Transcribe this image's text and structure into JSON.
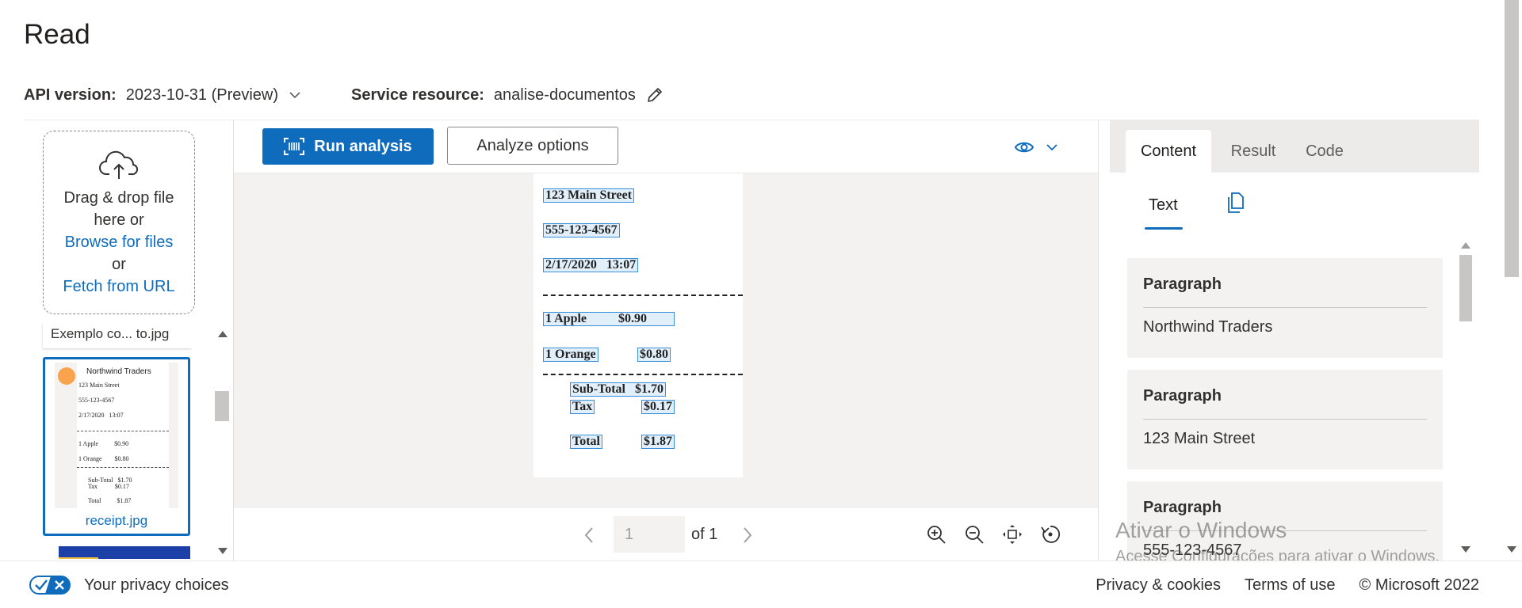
{
  "page": {
    "title": "Read"
  },
  "settings": {
    "api_version_label": "API version:",
    "api_version_value": "2023-10-31 (Preview)",
    "service_resource_label": "Service resource:",
    "service_resource_value": "analise-documentos"
  },
  "upload": {
    "line1": "Drag & drop file",
    "line2": "here or",
    "browse_link": "Browse for files",
    "or": "or",
    "fetch_link": "Fetch from URL"
  },
  "files": {
    "items": [
      {
        "name": "Exemplo co...  to.jpg",
        "selected": false
      },
      {
        "name": "receipt.jpg",
        "selected": true
      }
    ],
    "thumb_lines": {
      "company": "Northwind Traders",
      "street": "123 Main Street",
      "phone": "555-123-4567",
      "datetime": "2/17/2020   13:07",
      "apple": "1 Apple          $0.90",
      "orange": "1 Orange        $0.80",
      "subtotal": "Sub-Total   $1.70",
      "tax": "Tax           $0.17",
      "total": "Total          $1.87"
    }
  },
  "toolbar": {
    "run_label": "Run analysis",
    "analyze_label": "Analyze options"
  },
  "document": {
    "street": "123 Main Street",
    "phone": "555-123-4567",
    "datetime": "2/17/2020   13:07",
    "apple": "1 Apple          $0.90",
    "orange": "1 Orange",
    "orange_price": "$0.80",
    "subtotal": "Sub-Total   $1.70",
    "tax": "Tax",
    "tax_price": "$0.17",
    "total": "Total",
    "total_price": "$1.87"
  },
  "pager": {
    "current_page": "1",
    "of_text": "of 1"
  },
  "right_pane": {
    "tabs": [
      "Content",
      "Result",
      "Code"
    ],
    "active_tab": "Content",
    "subtab": "Text",
    "paragraphs": [
      {
        "title": "Paragraph",
        "text": "Northwind Traders"
      },
      {
        "title": "Paragraph",
        "text": "123 Main Street"
      },
      {
        "title": "Paragraph",
        "text": "555-123-4567"
      }
    ]
  },
  "watermark": {
    "line1": "Ativar o Windows",
    "line2": "Acesse Configurações para ativar o Windows."
  },
  "footer": {
    "privacy_choices": "Your privacy choices",
    "privacy_cookies": "Privacy & cookies",
    "terms": "Terms of use",
    "copyright": "© Microsoft 2022"
  },
  "colors": {
    "accent": "#0f6cbd",
    "highlight_border": "#3a8fd8",
    "thumb_dot": "#f9a44d"
  },
  "icons": [
    "chevron-down-icon",
    "pencil-icon",
    "cloud-upload-icon",
    "scan-icon",
    "eye-icon",
    "chevron-left-icon",
    "chevron-right-icon",
    "zoom-in-icon",
    "zoom-out-icon",
    "fit-page-icon",
    "rotate-icon",
    "copy-icon",
    "privacy-toggle-icon"
  ]
}
